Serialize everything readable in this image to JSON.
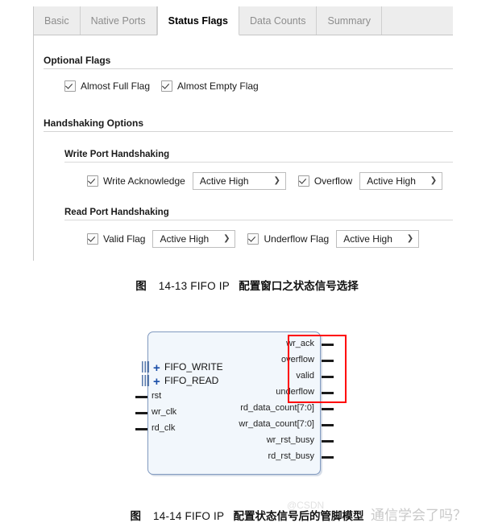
{
  "panel": {
    "tabs": [
      {
        "label": "Basic",
        "active": false
      },
      {
        "label": "Native Ports",
        "active": false
      },
      {
        "label": "Status Flags",
        "active": true
      },
      {
        "label": "Data Counts",
        "active": false
      },
      {
        "label": "Summary",
        "active": false
      }
    ],
    "optional_flags": {
      "heading": "Optional Flags",
      "items": [
        {
          "label": "Almost Full Flag",
          "checked": true
        },
        {
          "label": "Almost Empty Flag",
          "checked": true
        }
      ]
    },
    "handshaking": {
      "heading": "Handshaking Options",
      "write_port": {
        "heading": "Write Port Handshaking",
        "items": [
          {
            "label": "Write Acknowledge",
            "checked": true,
            "polarity": "Active High"
          },
          {
            "label": "Overflow",
            "checked": true,
            "polarity": "Active High"
          }
        ]
      },
      "read_port": {
        "heading": "Read Port Handshaking",
        "items": [
          {
            "label": "Valid Flag",
            "checked": true,
            "polarity": "Active High"
          },
          {
            "label": "Underflow Flag",
            "checked": true,
            "polarity": "Active High"
          }
        ]
      }
    }
  },
  "caption_1": {
    "fig": "图",
    "number": "14-13 FIFO IP",
    "text": "配置窗口之状态信号选择"
  },
  "caption_2": {
    "fig": "图",
    "number": "14-14 FIFO IP",
    "text": "配置状态信号后的管脚模型"
  },
  "watermark": {
    "text": "通信学会了吗？",
    "brand": "@CSDN"
  },
  "diagram": {
    "left_buses": [
      {
        "label": "FIFO_WRITE",
        "expander": "+"
      },
      {
        "label": "FIFO_READ",
        "expander": "+"
      }
    ],
    "left_pins": [
      "rst",
      "wr_clk",
      "rd_clk"
    ],
    "right_pins_highlighted": [
      "wr_ack",
      "overflow",
      "valid",
      "underflow"
    ],
    "right_pins": [
      "rd_data_count[7:0]",
      "wr_data_count[7:0]",
      "wr_rst_busy",
      "rd_rst_busy"
    ],
    "highlight_color": "#ff0000",
    "chip_fill": "#f2f7fc",
    "chip_border": "#8099bf"
  }
}
